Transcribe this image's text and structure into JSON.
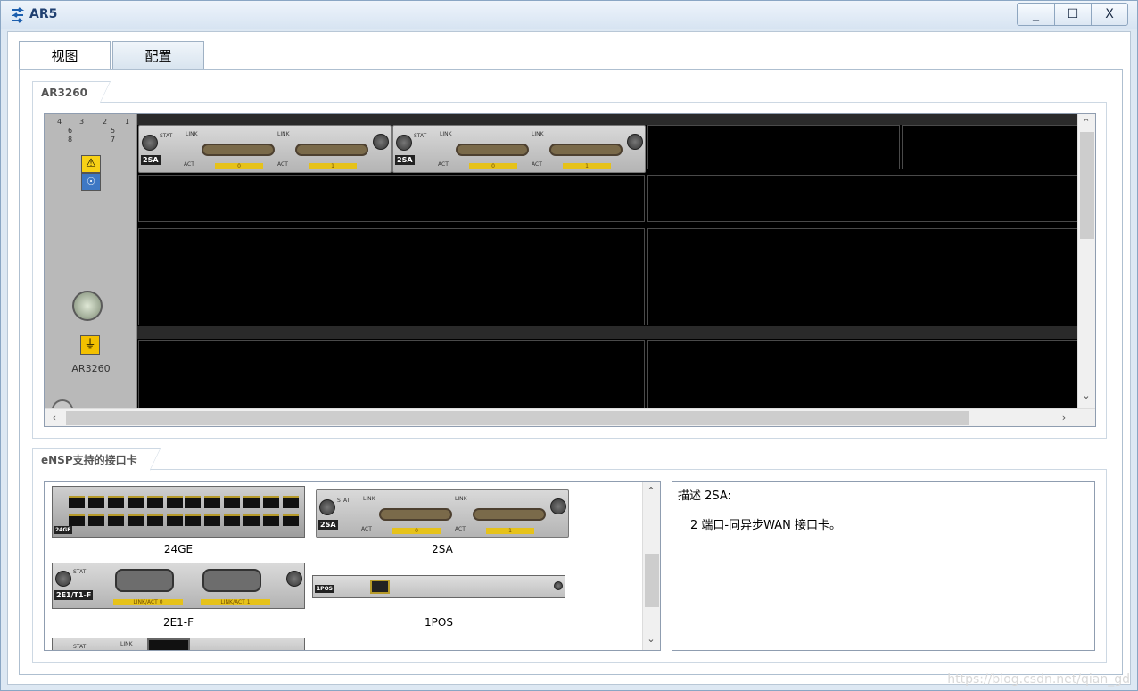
{
  "window": {
    "title": "AR5",
    "controls": {
      "minimize": "_",
      "maximize": "☐",
      "close": "X"
    }
  },
  "tabs": [
    {
      "label": "视图",
      "active": false
    },
    {
      "label": "配置",
      "active": true
    }
  ],
  "chassis_group": {
    "label": "AR3260",
    "chassis_model_label": "AR3260",
    "slot_numbers": [
      "4",
      "3",
      "2",
      "1",
      "6",
      "5",
      "8",
      "7"
    ],
    "installed_cards": [
      {
        "name": "2SA",
        "link_label": "LINK",
        "act_label": "ACT",
        "stat_label": "STAT",
        "ports": [
          "0",
          "1"
        ]
      },
      {
        "name": "2SA",
        "link_label": "LINK",
        "act_label": "ACT",
        "stat_label": "STAT",
        "ports": [
          "0",
          "1"
        ]
      }
    ]
  },
  "cards_group": {
    "label": "eNSP支持的接口卡",
    "cards": [
      {
        "name": "24GE",
        "tag": "24GE"
      },
      {
        "name": "2SA",
        "tag": "2SA",
        "link_label": "LINK",
        "act_label": "ACT",
        "stat_label": "STAT",
        "ports": [
          "0",
          "1"
        ]
      },
      {
        "name": "2E1-F",
        "tag": "2E1/T1-F",
        "stat_label": "STAT",
        "port_labels": [
          "LINK/ACT 0",
          "LINK/ACT 1"
        ]
      },
      {
        "name": "1POS",
        "tag": "1POS"
      }
    ],
    "partial_card": {
      "stat_label": "STAT",
      "link_label": "LINK"
    }
  },
  "description": {
    "title": "描述 2SA:",
    "body": "2 端口-同异步WAN 接口卡。"
  },
  "watermark": "https://blog.csdn.net/qian_gd",
  "colors": {
    "accent": "#1f3f70",
    "port_label": "#e6c21a"
  }
}
